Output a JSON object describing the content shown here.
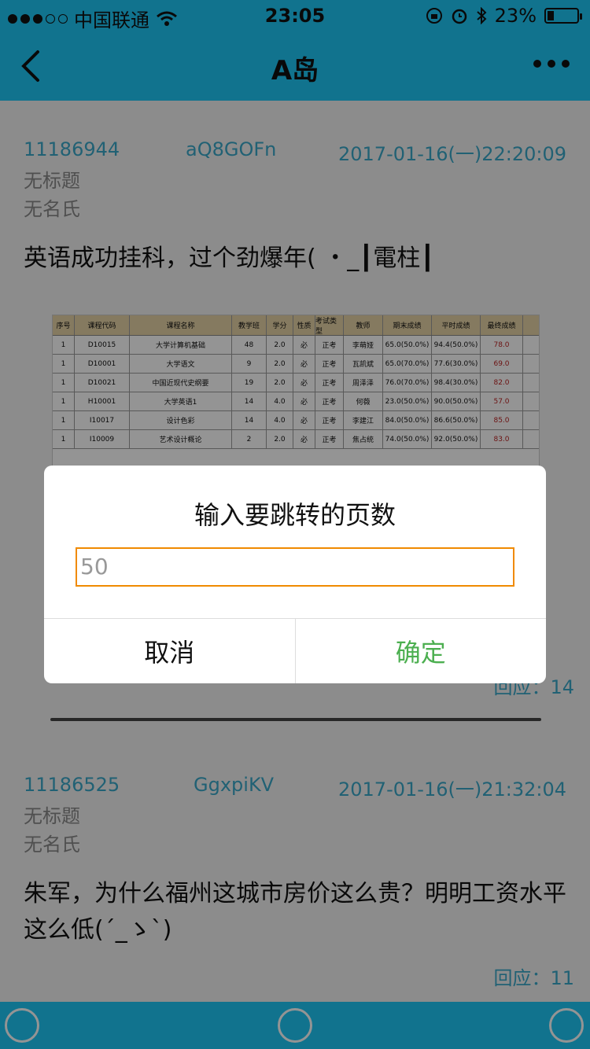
{
  "status_bar": {
    "carrier": "中国联通",
    "time": "23:05",
    "battery": "23%",
    "battery_level": 0.23
  },
  "nav": {
    "title": "A岛"
  },
  "posts": [
    {
      "id": "11186944",
      "uid": "aQ8GOFn",
      "time": "2017-01-16(一)22:20:09",
      "title": "无标题",
      "author": "无名氏",
      "content": "英语成功挂科，过个劲爆年( ・_┃電柱┃",
      "reply": "回应：14"
    },
    {
      "id": "11186525",
      "uid": "GgxpiKV",
      "time": "2017-01-16(一)21:32:04",
      "title": "无标题",
      "author": "无名氏",
      "content": "朱军，为什么福州这城市房价这么贵？明明工资水平这么低(´_ゝ`)",
      "reply": "回应：11"
    }
  ],
  "attachment_table": {
    "headers": [
      "序号",
      "课程代码",
      "课程名称",
      "教学班",
      "学分",
      "性质",
      "考试类型",
      "教师",
      "期末成绩",
      "平时成绩",
      "最终成绩"
    ],
    "rows": [
      [
        "1",
        "D10015",
        "大学计算机基础",
        "48",
        "2.0",
        "必",
        "正考",
        "李萌娅",
        "65.0(50.0%)",
        "94.4(50.0%)",
        "78.0"
      ],
      [
        "1",
        "D10001",
        "大学语文",
        "9",
        "2.0",
        "必",
        "正考",
        "瓦凯斌",
        "65.0(70.0%)",
        "77.6(30.0%)",
        "69.0"
      ],
      [
        "1",
        "D10021",
        "中国近现代史纲要",
        "19",
        "2.0",
        "必",
        "正考",
        "周泽泽",
        "76.0(70.0%)",
        "98.4(30.0%)",
        "82.0"
      ],
      [
        "1",
        "H10001",
        "大学英语1",
        "14",
        "4.0",
        "必",
        "正考",
        "何薇",
        "23.0(50.0%)",
        "90.0(50.0%)",
        "57.0"
      ],
      [
        "1",
        "I10017",
        "设计色彩",
        "14",
        "4.0",
        "必",
        "正考",
        "李建江",
        "84.0(50.0%)",
        "86.6(50.0%)",
        "85.0"
      ],
      [
        "1",
        "I10009",
        "艺术设计概论",
        "2",
        "2.0",
        "必",
        "正考",
        "焦占统",
        "74.0(50.0%)",
        "92.0(50.0%)",
        "83.0"
      ]
    ]
  },
  "dialog": {
    "title": "输入要跳转的页数",
    "input_placeholder": "50",
    "cancel_label": "取消",
    "ok_label": "确定"
  }
}
